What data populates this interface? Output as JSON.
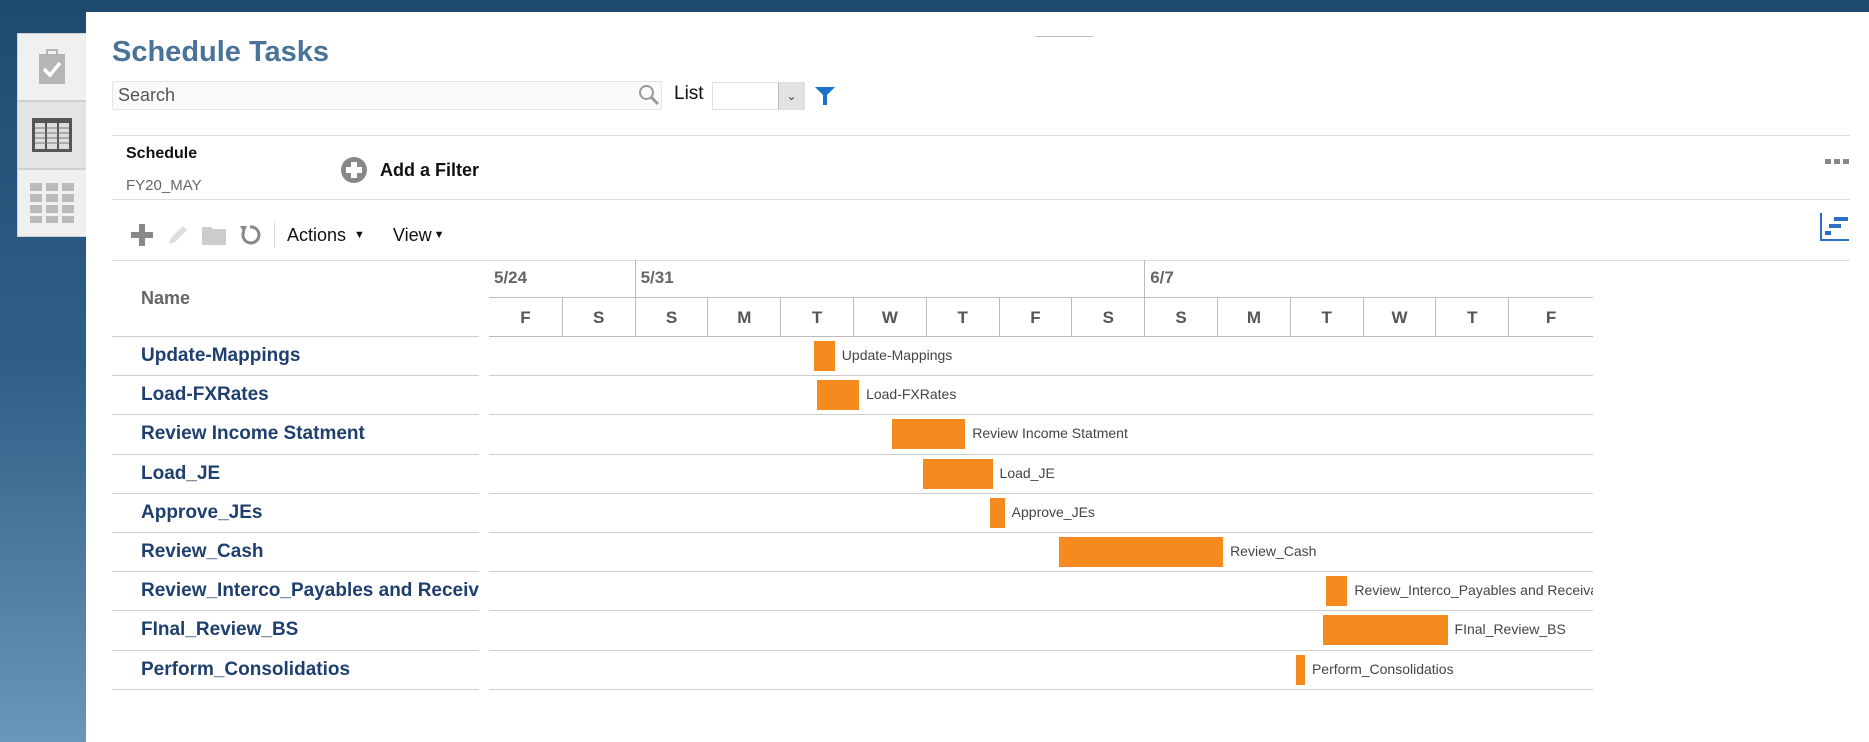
{
  "header": {
    "title": "Schedule Tasks"
  },
  "search": {
    "placeholder": "Search",
    "value": ""
  },
  "list": {
    "label": "List",
    "selected": ""
  },
  "filter_bar": {
    "schedule_label": "Schedule",
    "schedule_value": "FY20_MAY",
    "add_filter_label": "Add a Filter"
  },
  "toolbar": {
    "actions_label": "Actions",
    "view_label": "View"
  },
  "left_tabs": [
    {
      "icon": "clipboard-check-icon"
    },
    {
      "icon": "schedule-table-icon",
      "active": true
    },
    {
      "icon": "grid-icon"
    }
  ],
  "colors": {
    "accent": "#4a7399",
    "bar": "#f58a1f",
    "link": "#1f3f6e",
    "filter_icon": "#1a73c9"
  },
  "chart_data": {
    "type": "gantt",
    "name_header": "Name",
    "weeks": [
      {
        "label": "5/24",
        "first_day": "5/29"
      },
      {
        "label": "5/31",
        "first_day": "5/31"
      },
      {
        "label": "6/7",
        "first_day": "6/7"
      }
    ],
    "axis_start": "5/29",
    "days": [
      "F",
      "S",
      "S",
      "M",
      "T",
      "W",
      "T",
      "F",
      "S",
      "S",
      "M",
      "T",
      "W",
      "T",
      "F"
    ],
    "tasks": [
      {
        "name": "Update-Mappings",
        "start": "6/2 11:00",
        "end": "6/2 18:00"
      },
      {
        "name": "Load-FXRates",
        "start": "6/2 12:00",
        "end": "6/3 02:00"
      },
      {
        "name": "Review Income Statment",
        "start": "6/3 13:00",
        "end": "6/4 13:00"
      },
      {
        "name": "Load_JE",
        "start": "6/3 23:00",
        "end": "6/4 22:00"
      },
      {
        "name": "Approve_JEs",
        "start": "6/4 21:00",
        "end": "6/5 02:00"
      },
      {
        "name": "Review_Cash",
        "start": "6/5 20:00",
        "end": "6/8 02:00"
      },
      {
        "name": "Review_Interco_Payables and Receivables",
        "start": "6/9 12:00",
        "end": "6/9 19:00"
      },
      {
        "name": "FInal_Review_BS",
        "start": "6/9 11:00",
        "end": "6/11 04:00"
      },
      {
        "name": "Perform_Consolidatios",
        "start": "6/9 02:00",
        "end": "6/9 05:00"
      }
    ]
  }
}
